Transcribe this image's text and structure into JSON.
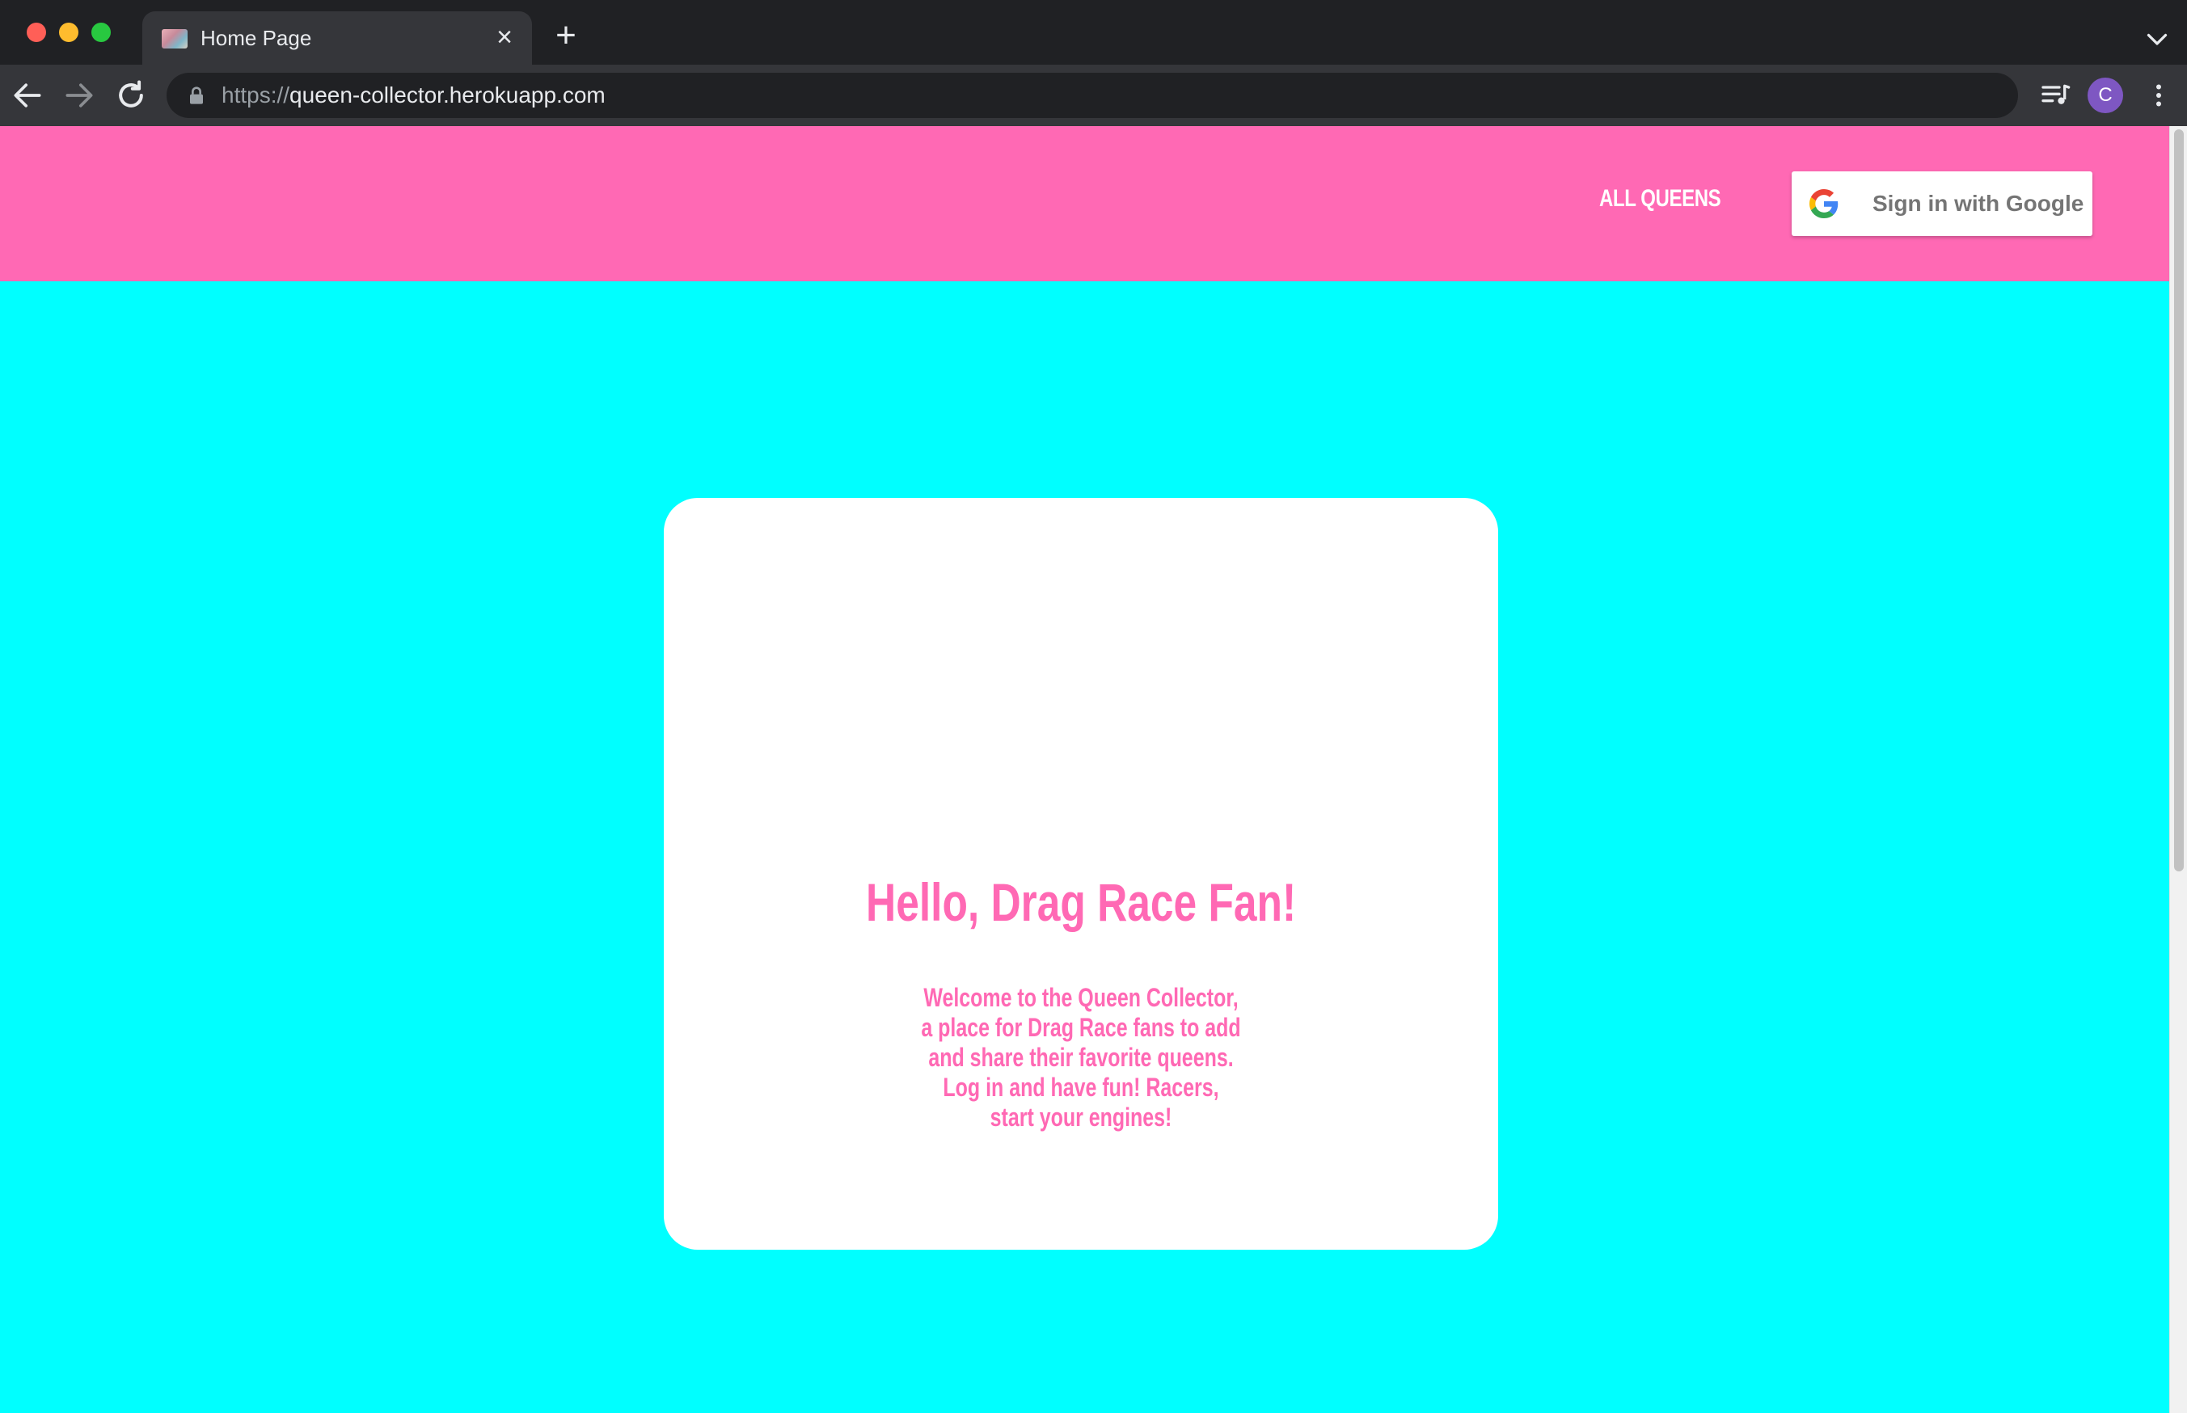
{
  "browser": {
    "tab": {
      "title": "Home Page"
    },
    "address_bar": {
      "scheme": "https://",
      "host": "queen-collector.herokuapp.com"
    },
    "profile_initial": "C"
  },
  "site": {
    "colors": {
      "nav_background": "#ff69b4",
      "page_background": "#00ffff",
      "accent_text": "#ff69b4"
    },
    "nav": {
      "all_queens_label": "ALL QUEENS",
      "sign_in_label": "Sign in with Google"
    },
    "hero": {
      "title": "Hello, Drag Race Fan!",
      "body": "Welcome to the Queen Collector, a place for Drag Race fans to add and share their favorite queens. Log in and have fun! Racers, start your engines!"
    }
  }
}
